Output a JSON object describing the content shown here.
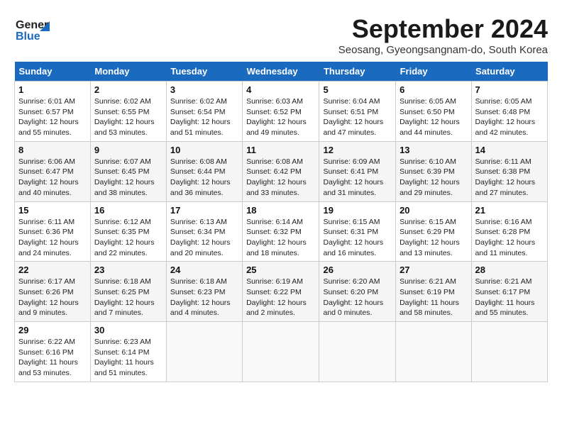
{
  "header": {
    "logo_line1": "General",
    "logo_line2": "Blue",
    "month_title": "September 2024",
    "location": "Seosang, Gyeongsangnam-do, South Korea"
  },
  "days_of_week": [
    "Sunday",
    "Monday",
    "Tuesday",
    "Wednesday",
    "Thursday",
    "Friday",
    "Saturday"
  ],
  "weeks": [
    [
      {
        "day": "1",
        "sunrise": "Sunrise: 6:01 AM",
        "sunset": "Sunset: 6:57 PM",
        "daylight": "Daylight: 12 hours and 55 minutes."
      },
      {
        "day": "2",
        "sunrise": "Sunrise: 6:02 AM",
        "sunset": "Sunset: 6:55 PM",
        "daylight": "Daylight: 12 hours and 53 minutes."
      },
      {
        "day": "3",
        "sunrise": "Sunrise: 6:02 AM",
        "sunset": "Sunset: 6:54 PM",
        "daylight": "Daylight: 12 hours and 51 minutes."
      },
      {
        "day": "4",
        "sunrise": "Sunrise: 6:03 AM",
        "sunset": "Sunset: 6:52 PM",
        "daylight": "Daylight: 12 hours and 49 minutes."
      },
      {
        "day": "5",
        "sunrise": "Sunrise: 6:04 AM",
        "sunset": "Sunset: 6:51 PM",
        "daylight": "Daylight: 12 hours and 47 minutes."
      },
      {
        "day": "6",
        "sunrise": "Sunrise: 6:05 AM",
        "sunset": "Sunset: 6:50 PM",
        "daylight": "Daylight: 12 hours and 44 minutes."
      },
      {
        "day": "7",
        "sunrise": "Sunrise: 6:05 AM",
        "sunset": "Sunset: 6:48 PM",
        "daylight": "Daylight: 12 hours and 42 minutes."
      }
    ],
    [
      {
        "day": "8",
        "sunrise": "Sunrise: 6:06 AM",
        "sunset": "Sunset: 6:47 PM",
        "daylight": "Daylight: 12 hours and 40 minutes."
      },
      {
        "day": "9",
        "sunrise": "Sunrise: 6:07 AM",
        "sunset": "Sunset: 6:45 PM",
        "daylight": "Daylight: 12 hours and 38 minutes."
      },
      {
        "day": "10",
        "sunrise": "Sunrise: 6:08 AM",
        "sunset": "Sunset: 6:44 PM",
        "daylight": "Daylight: 12 hours and 36 minutes."
      },
      {
        "day": "11",
        "sunrise": "Sunrise: 6:08 AM",
        "sunset": "Sunset: 6:42 PM",
        "daylight": "Daylight: 12 hours and 33 minutes."
      },
      {
        "day": "12",
        "sunrise": "Sunrise: 6:09 AM",
        "sunset": "Sunset: 6:41 PM",
        "daylight": "Daylight: 12 hours and 31 minutes."
      },
      {
        "day": "13",
        "sunrise": "Sunrise: 6:10 AM",
        "sunset": "Sunset: 6:39 PM",
        "daylight": "Daylight: 12 hours and 29 minutes."
      },
      {
        "day": "14",
        "sunrise": "Sunrise: 6:11 AM",
        "sunset": "Sunset: 6:38 PM",
        "daylight": "Daylight: 12 hours and 27 minutes."
      }
    ],
    [
      {
        "day": "15",
        "sunrise": "Sunrise: 6:11 AM",
        "sunset": "Sunset: 6:36 PM",
        "daylight": "Daylight: 12 hours and 24 minutes."
      },
      {
        "day": "16",
        "sunrise": "Sunrise: 6:12 AM",
        "sunset": "Sunset: 6:35 PM",
        "daylight": "Daylight: 12 hours and 22 minutes."
      },
      {
        "day": "17",
        "sunrise": "Sunrise: 6:13 AM",
        "sunset": "Sunset: 6:34 PM",
        "daylight": "Daylight: 12 hours and 20 minutes."
      },
      {
        "day": "18",
        "sunrise": "Sunrise: 6:14 AM",
        "sunset": "Sunset: 6:32 PM",
        "daylight": "Daylight: 12 hours and 18 minutes."
      },
      {
        "day": "19",
        "sunrise": "Sunrise: 6:15 AM",
        "sunset": "Sunset: 6:31 PM",
        "daylight": "Daylight: 12 hours and 16 minutes."
      },
      {
        "day": "20",
        "sunrise": "Sunrise: 6:15 AM",
        "sunset": "Sunset: 6:29 PM",
        "daylight": "Daylight: 12 hours and 13 minutes."
      },
      {
        "day": "21",
        "sunrise": "Sunrise: 6:16 AM",
        "sunset": "Sunset: 6:28 PM",
        "daylight": "Daylight: 12 hours and 11 minutes."
      }
    ],
    [
      {
        "day": "22",
        "sunrise": "Sunrise: 6:17 AM",
        "sunset": "Sunset: 6:26 PM",
        "daylight": "Daylight: 12 hours and 9 minutes."
      },
      {
        "day": "23",
        "sunrise": "Sunrise: 6:18 AM",
        "sunset": "Sunset: 6:25 PM",
        "daylight": "Daylight: 12 hours and 7 minutes."
      },
      {
        "day": "24",
        "sunrise": "Sunrise: 6:18 AM",
        "sunset": "Sunset: 6:23 PM",
        "daylight": "Daylight: 12 hours and 4 minutes."
      },
      {
        "day": "25",
        "sunrise": "Sunrise: 6:19 AM",
        "sunset": "Sunset: 6:22 PM",
        "daylight": "Daylight: 12 hours and 2 minutes."
      },
      {
        "day": "26",
        "sunrise": "Sunrise: 6:20 AM",
        "sunset": "Sunset: 6:20 PM",
        "daylight": "Daylight: 12 hours and 0 minutes."
      },
      {
        "day": "27",
        "sunrise": "Sunrise: 6:21 AM",
        "sunset": "Sunset: 6:19 PM",
        "daylight": "Daylight: 11 hours and 58 minutes."
      },
      {
        "day": "28",
        "sunrise": "Sunrise: 6:21 AM",
        "sunset": "Sunset: 6:17 PM",
        "daylight": "Daylight: 11 hours and 55 minutes."
      }
    ],
    [
      {
        "day": "29",
        "sunrise": "Sunrise: 6:22 AM",
        "sunset": "Sunset: 6:16 PM",
        "daylight": "Daylight: 11 hours and 53 minutes."
      },
      {
        "day": "30",
        "sunrise": "Sunrise: 6:23 AM",
        "sunset": "Sunset: 6:14 PM",
        "daylight": "Daylight: 11 hours and 51 minutes."
      },
      null,
      null,
      null,
      null,
      null
    ]
  ]
}
